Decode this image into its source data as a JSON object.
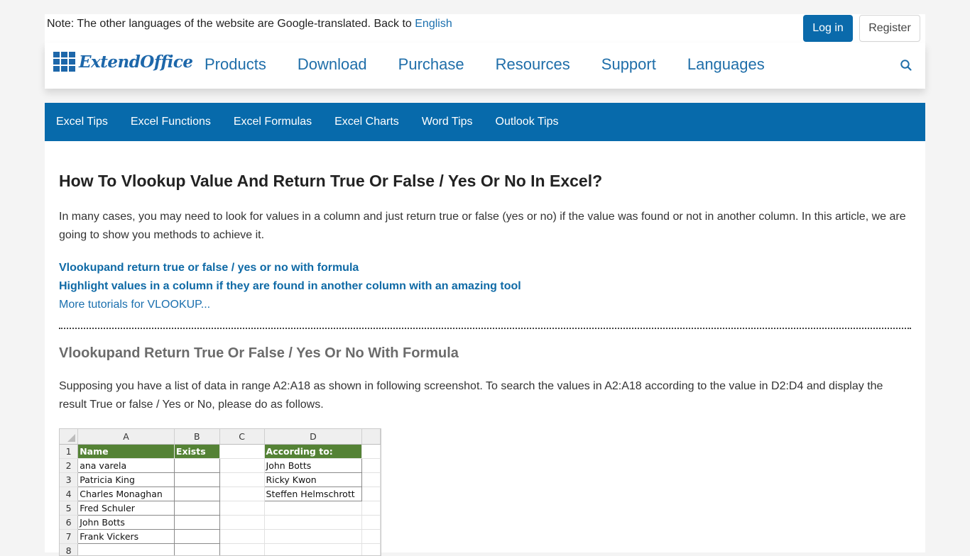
{
  "topbar": {
    "note_text": "Note: The other languages of the website are Google-translated. Back to ",
    "note_link": "English",
    "login_label": "Log in",
    "register_label": "Register"
  },
  "header": {
    "logo_text": "ExtendOffice",
    "nav": [
      "Products",
      "Download",
      "Purchase",
      "Resources",
      "Support",
      "Languages"
    ],
    "search_icon": "search-icon"
  },
  "subnav": [
    "Excel Tips",
    "Excel Functions",
    "Excel Formulas",
    "Excel Charts",
    "Word Tips",
    "Outlook Tips"
  ],
  "article": {
    "title": "How To Vlookup Value And Return True Or False / Yes Or No In Excel?",
    "intro": "In many cases, you may need to look for values in a column and just return true or false (yes or no) if the value was found or not in another column. In this article, we are going to show you methods to achieve it.",
    "toc": [
      "Vlookupand return true or false / yes or no with formula",
      "Highlight values in a column if they are found in another column with an amazing tool",
      "More tutorials for VLOOKUP..."
    ],
    "section_heading": "Vlookupand Return True Or False / Yes Or No With Formula",
    "section_para": "Supposing you have a list of data in range A2:A18 as shown in following screenshot. To search the values in A2:A18 according to the value in D2:D4 and display the result True or false / Yes or No, please do as follows."
  },
  "spreadsheet": {
    "columns": [
      "A",
      "B",
      "C",
      "D"
    ],
    "header_color": "#548235",
    "rows": [
      {
        "num": "1",
        "a": "Name",
        "b": "Exists",
        "c": "",
        "d": "According to:"
      },
      {
        "num": "2",
        "a": "ana varela",
        "b": "",
        "c": "",
        "d": "John Botts"
      },
      {
        "num": "3",
        "a": "Patricia King",
        "b": "",
        "c": "",
        "d": "Ricky Kwon"
      },
      {
        "num": "4",
        "a": "Charles Monaghan",
        "b": "",
        "c": "",
        "d": "Steffen Helmschrott"
      },
      {
        "num": "5",
        "a": "Fred Schuler",
        "b": "",
        "c": "",
        "d": ""
      },
      {
        "num": "6",
        "a": "John Botts",
        "b": "",
        "c": "",
        "d": ""
      },
      {
        "num": "7",
        "a": "Frank Vickers",
        "b": "",
        "c": "",
        "d": ""
      },
      {
        "num": "8",
        "a": "",
        "b": "",
        "c": "",
        "d": ""
      }
    ]
  },
  "colors": {
    "brand_blue": "#076aab",
    "link_blue": "#1a6fae"
  }
}
